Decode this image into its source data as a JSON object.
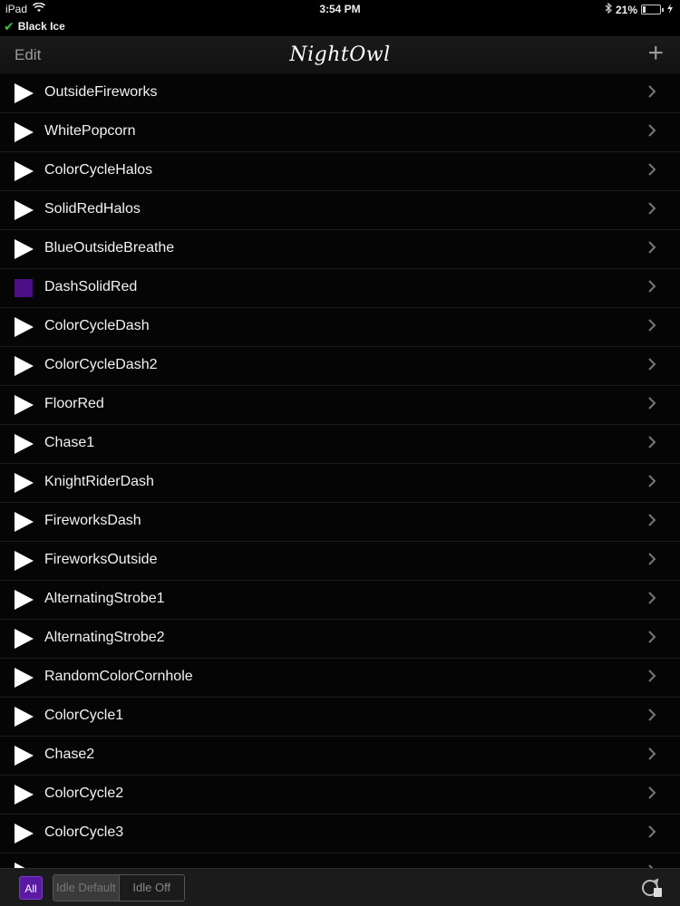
{
  "status_bar": {
    "device": "iPad",
    "time": "3:54 PM",
    "battery": "21%",
    "battery_level": 0.21
  },
  "connection": {
    "name": "Black Ice"
  },
  "nav": {
    "edit_label": "Edit",
    "title": "NightOwl",
    "add_label": "+"
  },
  "list": {
    "items": [
      {
        "label": "OutsideFireworks",
        "icon": "play-icon"
      },
      {
        "label": "WhitePopcorn",
        "icon": "play-icon"
      },
      {
        "label": "ColorCycleHalos",
        "icon": "play-icon"
      },
      {
        "label": "SolidRedHalos",
        "icon": "play-icon"
      },
      {
        "label": "BlueOutsideBreathe",
        "icon": "play-icon"
      },
      {
        "label": "DashSolidRed",
        "icon": "stop-icon"
      },
      {
        "label": "ColorCycleDash",
        "icon": "play-icon"
      },
      {
        "label": "ColorCycleDash2",
        "icon": "play-icon"
      },
      {
        "label": "FloorRed",
        "icon": "play-icon"
      },
      {
        "label": "Chase1",
        "icon": "play-icon"
      },
      {
        "label": "KnightRiderDash",
        "icon": "play-icon"
      },
      {
        "label": "FireworksDash",
        "icon": "play-icon"
      },
      {
        "label": "FireworksOutside",
        "icon": "play-icon"
      },
      {
        "label": "AlternatingStrobe1",
        "icon": "play-icon"
      },
      {
        "label": "AlternatingStrobe2",
        "icon": "play-icon"
      },
      {
        "label": "RandomColorCornhole",
        "icon": "play-icon"
      },
      {
        "label": "ColorCycle1",
        "icon": "play-icon"
      },
      {
        "label": "Chase2",
        "icon": "play-icon"
      },
      {
        "label": "ColorCycle2",
        "icon": "play-icon"
      },
      {
        "label": "ColorCycle3",
        "icon": "play-icon"
      },
      {
        "label": "",
        "icon": "play-icon"
      }
    ]
  },
  "toolbar": {
    "all_label": "All",
    "idle_default_label": "Idle Default",
    "idle_off_label": "Idle Off"
  },
  "colors": {
    "accent": "#5b1aa3",
    "stop": "#4b0e86",
    "check": "#3fbf3f"
  }
}
